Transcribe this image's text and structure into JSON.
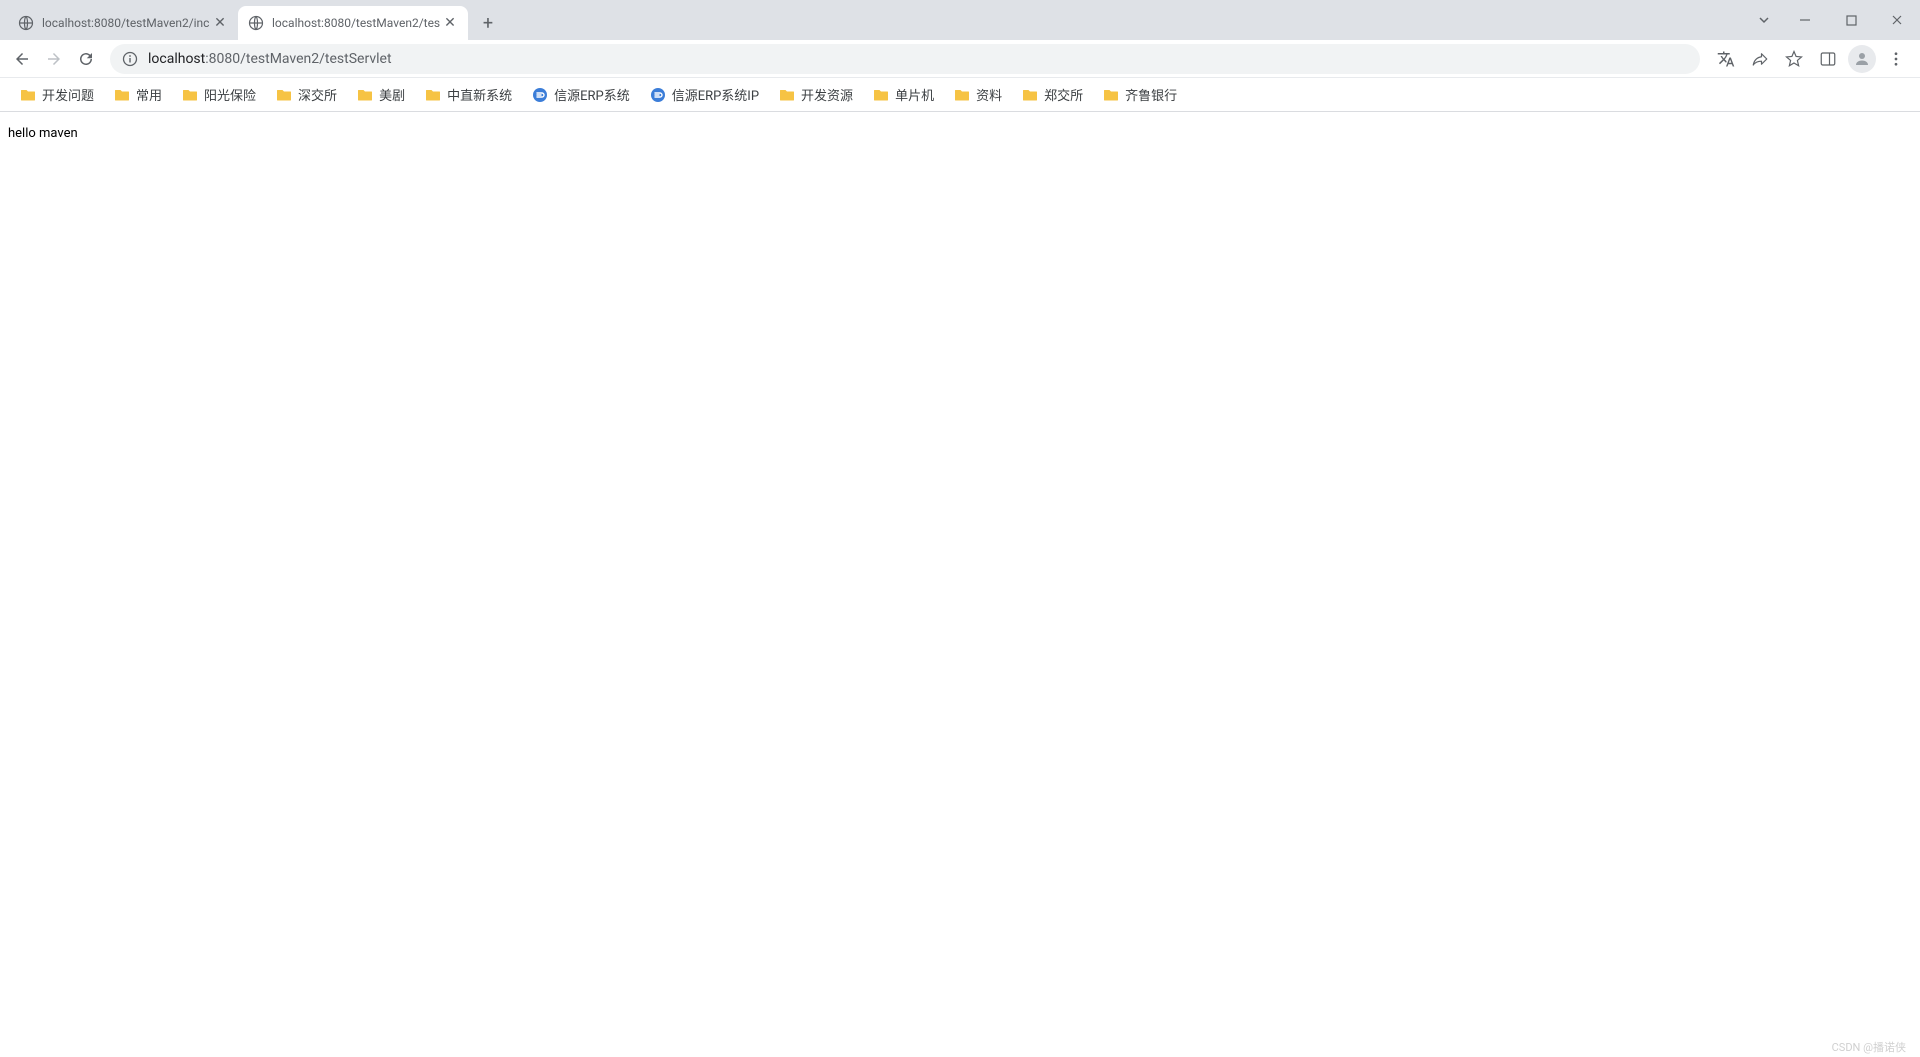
{
  "tabs": [
    {
      "title": "localhost:8080/testMaven2/inc",
      "active": false,
      "favicon": "globe"
    },
    {
      "title": "localhost:8080/testMaven2/tes",
      "active": true,
      "favicon": "globe"
    }
  ],
  "url": {
    "host": "localhost",
    "port_path": ":8080/testMaven2/testServlet"
  },
  "bookmarks": [
    {
      "label": "开发问题",
      "icon": "folder"
    },
    {
      "label": "常用",
      "icon": "folder"
    },
    {
      "label": "阳光保险",
      "icon": "folder"
    },
    {
      "label": "深交所",
      "icon": "folder"
    },
    {
      "label": "美剧",
      "icon": "folder"
    },
    {
      "label": "中直新系统",
      "icon": "folder"
    },
    {
      "label": "信源ERP系统",
      "icon": "eicon"
    },
    {
      "label": "信源ERP系统IP",
      "icon": "eicon"
    },
    {
      "label": "开发资源",
      "icon": "folder"
    },
    {
      "label": "单片机",
      "icon": "folder"
    },
    {
      "label": "资料",
      "icon": "folder"
    },
    {
      "label": "郑交所",
      "icon": "folder"
    },
    {
      "label": "齐鲁银行",
      "icon": "folder"
    }
  ],
  "page": {
    "body_text": "hello maven"
  },
  "watermark": "CSDN @播诺侠"
}
